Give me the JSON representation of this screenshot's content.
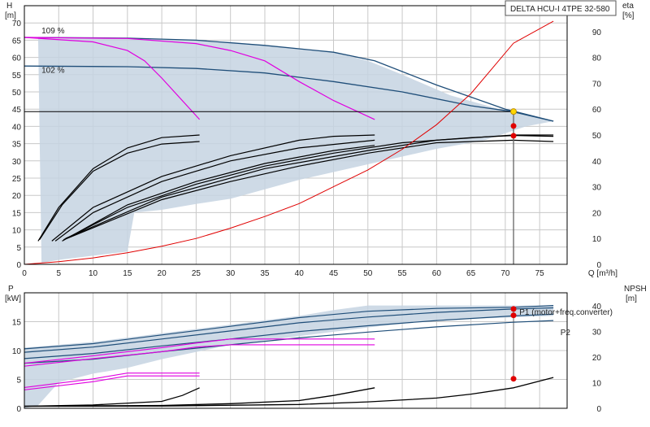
{
  "chart_data": [
    {
      "type": "line",
      "panel": "upper",
      "title": "DELTA HCU-I 4TPE 32-580",
      "xlabel": "Q [m³/h]",
      "ylabel_left": [
        "H",
        "[m]"
      ],
      "ylabel_right": [
        "eta",
        "[%]"
      ],
      "xlim": [
        0,
        79
      ],
      "ylim_left": [
        0,
        75
      ],
      "ylim_right": [
        0,
        100
      ],
      "xticks": [
        0,
        5,
        10,
        15,
        20,
        25,
        30,
        35,
        40,
        45,
        50,
        55,
        60,
        65,
        70,
        75
      ],
      "yticks_left": [
        0,
        5,
        10,
        15,
        20,
        25,
        30,
        35,
        40,
        45,
        50,
        55,
        60,
        65,
        70
      ],
      "yticks_right": [
        0,
        10,
        20,
        30,
        40,
        50,
        60,
        70,
        80,
        90
      ],
      "grid": true,
      "curve_labels": [
        {
          "text": "109 %",
          "at": [
            2.5,
            67
          ]
        },
        {
          "text": "102 %",
          "at": [
            2.5,
            55.5
          ]
        }
      ],
      "operating_area": [
        [
          2,
          66
        ],
        [
          12,
          65.8
        ],
        [
          30,
          64.5
        ],
        [
          45,
          61.5
        ],
        [
          50,
          59
        ],
        [
          55,
          55
        ],
        [
          62,
          49
        ],
        [
          70,
          44.5
        ],
        [
          77,
          41.5
        ],
        [
          73,
          40
        ],
        [
          67,
          36
        ],
        [
          60,
          33.5
        ],
        [
          50,
          29
        ],
        [
          40,
          24.5
        ],
        [
          30,
          19
        ],
        [
          25,
          17.5
        ],
        [
          20,
          15.8
        ],
        [
          16,
          15
        ],
        [
          15,
          3.7
        ],
        [
          10,
          2.5
        ],
        [
          5,
          1.3
        ],
        [
          2.5,
          0.4
        ]
      ],
      "h_max_curve": [
        [
          0,
          65.8
        ],
        [
          15,
          65.6
        ],
        [
          25,
          65
        ],
        [
          35,
          63.5
        ],
        [
          45,
          61.5
        ],
        [
          51,
          59
        ],
        [
          60,
          52
        ],
        [
          70,
          45
        ],
        [
          77,
          41.5
        ]
      ],
      "h_curve_102": [
        [
          0,
          57.5
        ],
        [
          15,
          57.3
        ],
        [
          25,
          56.8
        ],
        [
          35,
          55.5
        ],
        [
          45,
          53
        ],
        [
          55,
          50
        ],
        [
          65,
          46
        ],
        [
          71,
          44.3
        ],
        [
          77,
          41.5
        ]
      ],
      "operating_line_h": [
        [
          0,
          44.3
        ],
        [
          71.2,
          44.3
        ]
      ],
      "magenta_lines": [
        [
          [
            0,
            65.8
          ],
          [
            10,
            64.5
          ],
          [
            15,
            62
          ],
          [
            17.5,
            59
          ],
          [
            20,
            54
          ],
          [
            25.5,
            42
          ]
        ],
        [
          [
            0,
            65.8
          ],
          [
            15,
            65.5
          ],
          [
            25,
            64
          ],
          [
            30,
            62
          ],
          [
            35,
            59
          ],
          [
            40,
            53
          ],
          [
            45,
            47.5
          ],
          [
            51,
            42
          ]
        ]
      ],
      "eta_curve_red": [
        [
          0,
          0
        ],
        [
          5,
          1
        ],
        [
          10,
          2.5
        ],
        [
          15,
          4.5
        ],
        [
          20,
          7
        ],
        [
          25,
          10
        ],
        [
          30,
          14
        ],
        [
          35,
          18.5
        ],
        [
          40,
          23.5
        ],
        [
          45,
          30
        ],
        [
          50,
          36.5
        ],
        [
          55,
          44.5
        ],
        [
          60,
          54
        ],
        [
          65,
          66
        ],
        [
          71.2,
          85.5
        ],
        [
          77,
          94
        ]
      ],
      "eta_curves_black": [
        [
          [
            2,
            9
          ],
          [
            5,
            22
          ],
          [
            10,
            37
          ],
          [
            15,
            45
          ],
          [
            20,
            49
          ],
          [
            25.5,
            50
          ]
        ],
        [
          [
            2.2,
            9.5
          ],
          [
            5.5,
            23
          ],
          [
            10,
            36
          ],
          [
            15,
            43
          ],
          [
            20,
            46.5
          ],
          [
            25.5,
            47.5
          ]
        ],
        [
          [
            4,
            9
          ],
          [
            10,
            22
          ],
          [
            20,
            34
          ],
          [
            30,
            42
          ],
          [
            40,
            48
          ],
          [
            45,
            49.5
          ],
          [
            51,
            50
          ]
        ],
        [
          [
            4.5,
            9
          ],
          [
            10,
            20
          ],
          [
            20,
            32
          ],
          [
            30,
            40
          ],
          [
            40,
            45
          ],
          [
            51,
            48
          ]
        ],
        [
          [
            5.5,
            9
          ],
          [
            15,
            23
          ],
          [
            25,
            32
          ],
          [
            35,
            39
          ],
          [
            45,
            44
          ],
          [
            51,
            46
          ]
        ],
        [
          [
            5.7,
            9.5
          ],
          [
            15,
            22
          ],
          [
            25,
            31
          ],
          [
            35,
            38
          ],
          [
            45,
            43
          ],
          [
            55,
            47
          ],
          [
            65,
            49
          ],
          [
            71.2,
            49.8
          ],
          [
            77,
            49.5
          ]
        ],
        [
          [
            6,
            10
          ],
          [
            20,
            26
          ],
          [
            35,
            37
          ],
          [
            50,
            44
          ],
          [
            60,
            48
          ],
          [
            71.2,
            50
          ],
          [
            77,
            50
          ]
        ],
        [
          [
            6.2,
            10
          ],
          [
            20,
            25
          ],
          [
            30,
            32
          ],
          [
            40,
            38
          ],
          [
            50,
            43
          ],
          [
            60,
            47
          ],
          [
            71.2,
            48
          ],
          [
            77,
            47.5
          ]
        ]
      ],
      "operating_point": {
        "q": 71.2,
        "h": 44.3
      },
      "eta_points": [
        53.5,
        49.7
      ]
    },
    {
      "type": "line",
      "panel": "lower",
      "ylabel_left": [
        "P",
        "[kW]"
      ],
      "ylabel_right": [
        "NPSH",
        "[m]"
      ],
      "xlim": [
        0,
        79
      ],
      "ylim_left": [
        0,
        20
      ],
      "ylim_right": [
        0,
        45
      ],
      "yticks_left": [
        0,
        5,
        10,
        15
      ],
      "yticks_right": [
        0,
        10,
        20,
        30,
        40
      ],
      "series_labels": [
        "P1 (motor+freq.converter)",
        "P2"
      ],
      "p_area": [
        [
          0,
          10.5
        ],
        [
          10,
          11.5
        ],
        [
          20,
          13
        ],
        [
          30,
          14.5
        ],
        [
          40,
          16
        ],
        [
          45,
          17
        ],
        [
          50,
          17.8
        ],
        [
          77,
          17.8
        ],
        [
          77,
          16
        ],
        [
          60,
          15.3
        ],
        [
          50,
          14
        ],
        [
          40,
          12.5
        ],
        [
          30,
          11
        ],
        [
          20,
          8.5
        ],
        [
          15,
          7
        ],
        [
          10,
          6
        ],
        [
          5,
          4.5
        ],
        [
          2,
          0.5
        ],
        [
          0,
          0
        ]
      ],
      "p_curves": [
        [
          [
            0,
            10.3
          ],
          [
            10,
            11.2
          ],
          [
            20,
            12.7
          ],
          [
            30,
            14.2
          ],
          [
            40,
            15.7
          ],
          [
            50,
            16.8
          ],
          [
            60,
            17.3
          ],
          [
            71.2,
            17.5
          ],
          [
            77,
            17.8
          ]
        ],
        [
          [
            0,
            9.7
          ],
          [
            10,
            10.6
          ],
          [
            20,
            12
          ],
          [
            30,
            13.4
          ],
          [
            40,
            14.8
          ],
          [
            50,
            15.8
          ],
          [
            60,
            16.6
          ],
          [
            71.2,
            17.2
          ],
          [
            77,
            17.4
          ]
        ],
        [
          [
            0,
            8.6
          ],
          [
            10,
            9.5
          ],
          [
            20,
            10.8
          ],
          [
            30,
            12
          ],
          [
            40,
            13.3
          ],
          [
            50,
            14.3
          ],
          [
            60,
            15.2
          ],
          [
            71.2,
            16
          ],
          [
            77,
            16.3
          ]
        ],
        [
          [
            0,
            7.8
          ],
          [
            10,
            8.5
          ],
          [
            20,
            9.8
          ],
          [
            30,
            11
          ],
          [
            40,
            12.2
          ],
          [
            50,
            13.2
          ],
          [
            60,
            14.1
          ],
          [
            71.2,
            14.9
          ],
          [
            77,
            15.2
          ]
        ]
      ],
      "p_magenta": [
        [
          [
            0,
            7.3
          ],
          [
            10,
            8.6
          ],
          [
            20,
            9.8
          ],
          [
            25,
            10.6
          ],
          [
            30,
            11
          ],
          [
            40,
            11
          ],
          [
            51,
            11
          ]
        ],
        [
          [
            0,
            7.8
          ],
          [
            10,
            9.1
          ],
          [
            20,
            10.5
          ],
          [
            25,
            11.3
          ],
          [
            30,
            12
          ],
          [
            40,
            12
          ],
          [
            51,
            12
          ]
        ],
        [
          [
            0,
            3.2
          ],
          [
            10,
            4.6
          ],
          [
            15,
            5.6
          ],
          [
            20,
            5.6
          ],
          [
            25.5,
            5.6
          ]
        ],
        [
          [
            0,
            3.6
          ],
          [
            10,
            5.1
          ],
          [
            15,
            6.1
          ],
          [
            20,
            6.1
          ],
          [
            25.5,
            6.1
          ]
        ]
      ],
      "npsh_curves": [
        [
          [
            0,
            0.8
          ],
          [
            10,
            1.3
          ],
          [
            20,
            2.7
          ],
          [
            23,
            5
          ],
          [
            25.5,
            8
          ]
        ],
        [
          [
            0,
            0.8
          ],
          [
            20,
            1.1
          ],
          [
            30,
            1.8
          ],
          [
            40,
            3
          ],
          [
            45,
            5
          ],
          [
            51,
            8
          ]
        ],
        [
          [
            0,
            0.8
          ],
          [
            20,
            0.9
          ],
          [
            40,
            1.5
          ],
          [
            50,
            2.5
          ],
          [
            60,
            4
          ],
          [
            65,
            5.5
          ],
          [
            71.2,
            8
          ],
          [
            77,
            12
          ]
        ]
      ],
      "p_points": [
        17.2,
        16.1
      ],
      "npsh_point": 11.5
    }
  ]
}
